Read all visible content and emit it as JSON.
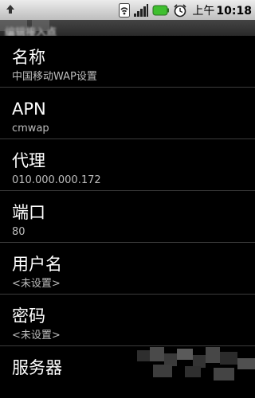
{
  "status_bar": {
    "ampm": "上午",
    "time": "10:18",
    "icons": [
      "upload-icon",
      "wifi-signal-icon",
      "cell-signal-icon",
      "battery-icon",
      "alarm-clock-icon"
    ]
  },
  "title_bar": {
    "title": "编辑接入点"
  },
  "settings": {
    "items": [
      {
        "label": "名称",
        "value": "中国移动WAP设置"
      },
      {
        "label": "APN",
        "value": "cmwap"
      },
      {
        "label": "代理",
        "value": "010.000.000.172"
      },
      {
        "label": "端口",
        "value": "80"
      },
      {
        "label": "用户名",
        "value": "<未设置>"
      },
      {
        "label": "密码",
        "value": "<未设置>"
      },
      {
        "label": "服务器",
        "value": ""
      }
    ]
  },
  "colors": {
    "background": "#000000",
    "status_bar": "#d6d6d6",
    "label": "#ffffff",
    "value": "#bdbdbd",
    "divider": "#3c3c3c",
    "battery": "#3fbf2f"
  }
}
